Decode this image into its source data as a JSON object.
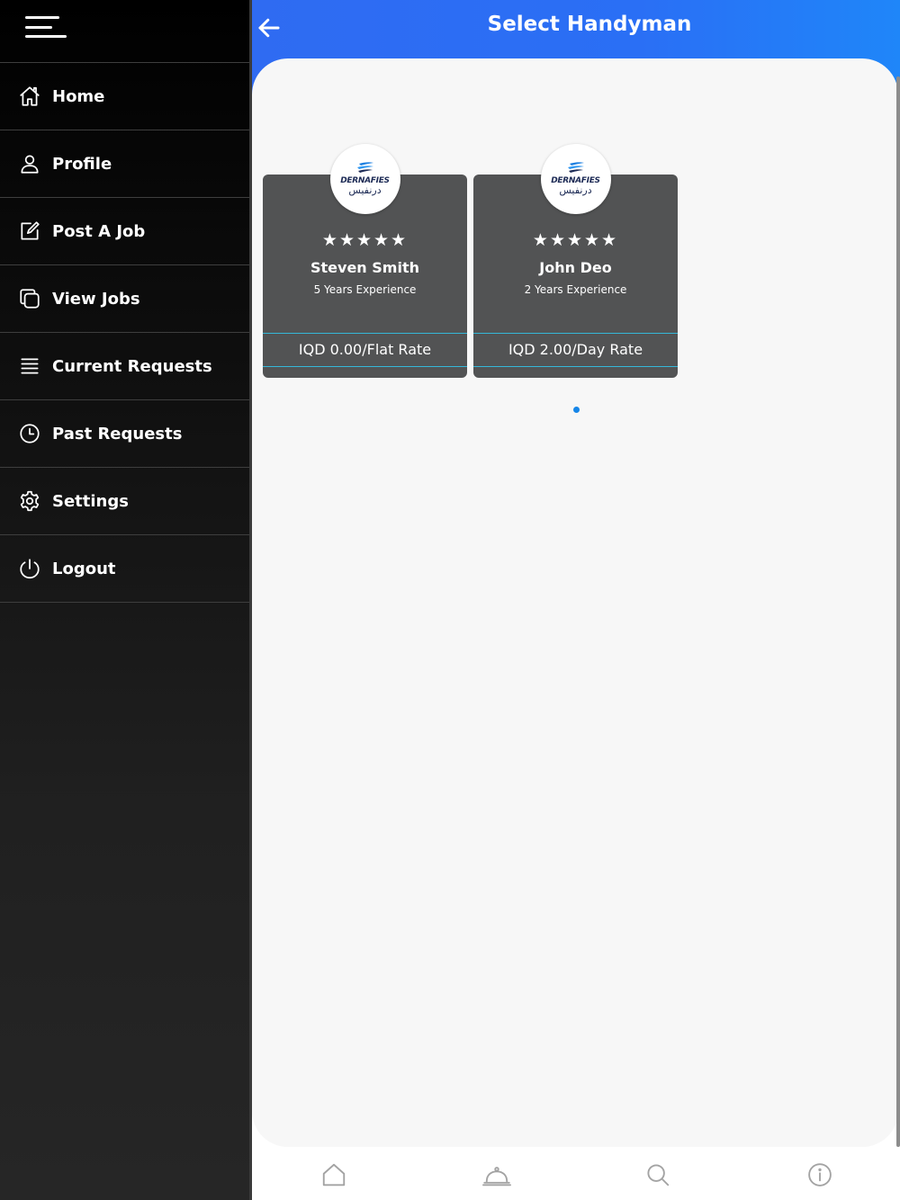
{
  "drawer": {
    "items": [
      {
        "label": "Home",
        "icon": "home-icon"
      },
      {
        "label": "Profile",
        "icon": "user-icon"
      },
      {
        "label": "Post A Job",
        "icon": "edit-icon"
      },
      {
        "label": "View Jobs",
        "icon": "copy-icon"
      },
      {
        "label": "Current Requests",
        "icon": "list-icon"
      },
      {
        "label": "Past Requests",
        "icon": "clock-icon"
      },
      {
        "label": "Settings",
        "icon": "gear-icon"
      },
      {
        "label": "Logout",
        "icon": "power-icon"
      }
    ]
  },
  "header": {
    "title": "Select Handyman"
  },
  "handymen": [
    {
      "name": "Steven Smith",
      "experience": "5 Years Experience",
      "rate": "IQD 0.00/Flat Rate",
      "stars": "★★★★★",
      "logo_text": "DERNAFIES",
      "logo_text_ar": "درنفيس"
    },
    {
      "name": "John Deo",
      "experience": "2 Years Experience",
      "rate": "IQD 2.00/Day Rate",
      "stars": "★★★★★",
      "logo_text": "DERNAFIES",
      "logo_text_ar": "درنفيس"
    }
  ],
  "bottom_nav": [
    "home-icon",
    "service-bell-icon",
    "search-icon",
    "info-icon"
  ],
  "colors": {
    "header_blue": "#2f6bf2",
    "card_gray": "#525354",
    "accent_cyan": "#35b7d8",
    "pager_dot": "#1686e8"
  }
}
